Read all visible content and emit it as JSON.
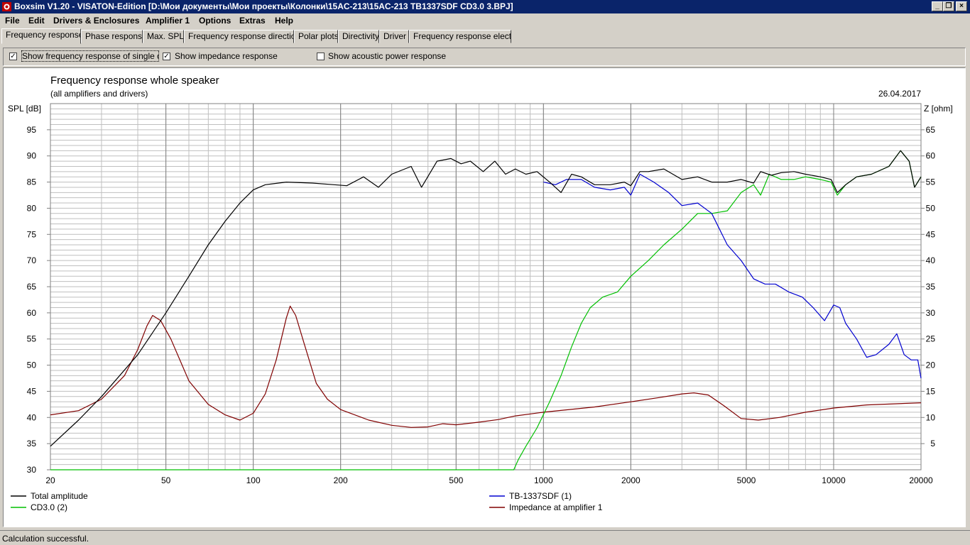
{
  "window": {
    "title": "Boxsim V1.20 - VISATON-Edition [D:\\Мои документы\\Мои проекты\\Колонки\\15AC-213\\15AC-213 TB1337SDF CD3.0 3.BPJ]",
    "minimize_glyph": "_",
    "restore_glyph": "❐",
    "close_glyph": "×"
  },
  "menu": [
    "File",
    "Edit",
    "Drivers & Enclosures",
    "Amplifier 1",
    "Options",
    "Extras",
    "Help"
  ],
  "tabs": [
    "Frequency response.",
    "Phase response",
    "Max. SPL",
    "Frequency response directions",
    "Polar plots",
    "Directivity",
    "Driver",
    "Frequency response electr."
  ],
  "active_tab": 0,
  "options": [
    {
      "label": "Show frequency response of single drive",
      "checked": true
    },
    {
      "label": "Show impedance response",
      "checked": true
    },
    {
      "label": "Show acoustic power response",
      "checked": false
    }
  ],
  "status": "Calculation successful.",
  "colors": {
    "total": "#000000",
    "cd30": "#00c000",
    "tb": "#0000d0",
    "impedance": "#800000",
    "grid": "#bfbfbf",
    "grid_major": "#808080"
  },
  "chart_data": {
    "type": "line",
    "title": "Frequency response whole speaker",
    "subtitle": "(all amplifiers and drivers)",
    "date": "26.04.2017",
    "ylabel": "SPL [dB]",
    "ylabel_right": "Z [ohm]",
    "x_scale": "log",
    "xlim": [
      20,
      20000
    ],
    "ylim": [
      30,
      100
    ],
    "ylim_right": [
      0,
      70
    ],
    "x_ticks": [
      20,
      50,
      100,
      200,
      500,
      1000,
      2000,
      5000,
      10000,
      20000
    ],
    "x_tick_labels": [
      "20",
      "50",
      "100",
      "200",
      "500",
      "1000",
      "2000",
      "5000",
      "10000",
      "20000"
    ],
    "y_ticks": [
      30,
      35,
      40,
      45,
      50,
      55,
      60,
      65,
      70,
      75,
      80,
      85,
      90,
      95
    ],
    "y_right_ticks": [
      5,
      10,
      15,
      20,
      25,
      30,
      35,
      40,
      45,
      50,
      55,
      60,
      65
    ],
    "grid": true,
    "legend_placement": "bottom",
    "series": [
      {
        "name": "Total amplitude",
        "axis": "left",
        "color_key": "total",
        "points": [
          [
            20,
            34.5
          ],
          [
            25,
            39.5
          ],
          [
            30,
            44
          ],
          [
            40,
            52
          ],
          [
            50,
            60
          ],
          [
            60,
            67
          ],
          [
            70,
            73
          ],
          [
            80,
            77.5
          ],
          [
            90,
            81
          ],
          [
            100,
            83.5
          ],
          [
            110,
            84.5
          ],
          [
            130,
            85
          ],
          [
            160,
            84.8
          ],
          [
            190,
            84.5
          ],
          [
            210,
            84.3
          ],
          [
            240,
            86
          ],
          [
            270,
            84
          ],
          [
            300,
            86.5
          ],
          [
            350,
            88
          ],
          [
            380,
            84
          ],
          [
            430,
            89
          ],
          [
            480,
            89.5
          ],
          [
            520,
            88.5
          ],
          [
            560,
            89
          ],
          [
            620,
            87
          ],
          [
            680,
            89
          ],
          [
            740,
            86.5
          ],
          [
            800,
            87.5
          ],
          [
            870,
            86.5
          ],
          [
            950,
            87
          ],
          [
            1050,
            85
          ],
          [
            1150,
            83
          ],
          [
            1250,
            86.5
          ],
          [
            1350,
            86
          ],
          [
            1500,
            84.5
          ],
          [
            1700,
            84.5
          ],
          [
            1900,
            85
          ],
          [
            2000,
            84.3
          ],
          [
            2150,
            87
          ],
          [
            2300,
            87
          ],
          [
            2600,
            87.5
          ],
          [
            3000,
            85.5
          ],
          [
            3400,
            86
          ],
          [
            3800,
            85
          ],
          [
            4300,
            85
          ],
          [
            4800,
            85.5
          ],
          [
            5300,
            84.8
          ],
          [
            5600,
            87
          ],
          [
            6100,
            86.3
          ],
          [
            6600,
            86.8
          ],
          [
            7300,
            87
          ],
          [
            8000,
            86.5
          ],
          [
            9000,
            86
          ],
          [
            9800,
            85.5
          ],
          [
            10300,
            83
          ],
          [
            11000,
            84.5
          ],
          [
            12000,
            86
          ],
          [
            13500,
            86.5
          ],
          [
            15500,
            88
          ],
          [
            17000,
            91
          ],
          [
            18200,
            89
          ],
          [
            19000,
            84
          ],
          [
            20000,
            86
          ]
        ]
      },
      {
        "name": "TB-1337SDF (1)",
        "axis": "left",
        "color_key": "tb",
        "points": [
          [
            1000,
            85
          ],
          [
            1100,
            84.5
          ],
          [
            1200,
            85.5
          ],
          [
            1350,
            85.5
          ],
          [
            1500,
            84
          ],
          [
            1700,
            83.5
          ],
          [
            1900,
            84
          ],
          [
            2000,
            82.5
          ],
          [
            2150,
            86.5
          ],
          [
            2400,
            85
          ],
          [
            2700,
            83
          ],
          [
            3000,
            80.5
          ],
          [
            3400,
            81
          ],
          [
            3800,
            79
          ],
          [
            4300,
            73
          ],
          [
            4800,
            70
          ],
          [
            5300,
            66.5
          ],
          [
            5800,
            65.5
          ],
          [
            6300,
            65.5
          ],
          [
            7000,
            64
          ],
          [
            7800,
            63
          ],
          [
            8500,
            61
          ],
          [
            9300,
            58.5
          ],
          [
            10000,
            61.5
          ],
          [
            10500,
            61
          ],
          [
            11000,
            58
          ],
          [
            12000,
            55
          ],
          [
            13000,
            51.5
          ],
          [
            14000,
            52
          ],
          [
            15500,
            54
          ],
          [
            16500,
            56
          ],
          [
            17500,
            52
          ],
          [
            18500,
            51
          ],
          [
            19500,
            51
          ],
          [
            20000,
            47.5
          ]
        ]
      },
      {
        "name": "CD3.0 (2)",
        "axis": "left",
        "color_key": "cd30",
        "points": [
          [
            20,
            30
          ],
          [
            790,
            30
          ],
          [
            820,
            32
          ],
          [
            870,
            34.5
          ],
          [
            950,
            38
          ],
          [
            1050,
            43
          ],
          [
            1150,
            48
          ],
          [
            1250,
            53.5
          ],
          [
            1350,
            58
          ],
          [
            1450,
            61
          ],
          [
            1600,
            63
          ],
          [
            1800,
            64
          ],
          [
            2000,
            67
          ],
          [
            2300,
            70
          ],
          [
            2600,
            73
          ],
          [
            3000,
            76
          ],
          [
            3400,
            79
          ],
          [
            3800,
            79
          ],
          [
            4300,
            79.5
          ],
          [
            4800,
            83
          ],
          [
            5300,
            84.5
          ],
          [
            5600,
            82.5
          ],
          [
            6000,
            86.5
          ],
          [
            6600,
            85.5
          ],
          [
            7300,
            85.5
          ],
          [
            8000,
            86
          ],
          [
            9000,
            85.5
          ],
          [
            9800,
            85
          ],
          [
            10300,
            82.5
          ],
          [
            11000,
            84.5
          ],
          [
            12000,
            86
          ],
          [
            13500,
            86.5
          ],
          [
            15500,
            88
          ],
          [
            17000,
            91
          ],
          [
            18200,
            89
          ],
          [
            19000,
            84
          ],
          [
            20000,
            86
          ]
        ]
      },
      {
        "name": "Impedance at amplifier 1",
        "axis": "right",
        "color_key": "impedance",
        "points": [
          [
            20,
            10.5
          ],
          [
            25,
            11.3
          ],
          [
            30,
            13.5
          ],
          [
            36,
            18
          ],
          [
            40,
            23
          ],
          [
            43,
            27.5
          ],
          [
            45,
            29.5
          ],
          [
            48,
            28.5
          ],
          [
            52,
            25
          ],
          [
            60,
            17
          ],
          [
            70,
            12.5
          ],
          [
            80,
            10.5
          ],
          [
            90,
            9.5
          ],
          [
            100,
            10.8
          ],
          [
            110,
            14.5
          ],
          [
            120,
            21
          ],
          [
            130,
            29
          ],
          [
            134,
            31.3
          ],
          [
            140,
            29.5
          ],
          [
            150,
            24
          ],
          [
            165,
            16.5
          ],
          [
            180,
            13.5
          ],
          [
            200,
            11.5
          ],
          [
            250,
            9.5
          ],
          [
            300,
            8.5
          ],
          [
            350,
            8.1
          ],
          [
            400,
            8.2
          ],
          [
            450,
            8.8
          ],
          [
            500,
            8.6
          ],
          [
            600,
            9.1
          ],
          [
            700,
            9.6
          ],
          [
            800,
            10.3
          ],
          [
            1000,
            11
          ],
          [
            1500,
            12
          ],
          [
            2000,
            13
          ],
          [
            2500,
            13.8
          ],
          [
            3000,
            14.5
          ],
          [
            3300,
            14.7
          ],
          [
            3700,
            14.3
          ],
          [
            4200,
            12.2
          ],
          [
            4800,
            9.8
          ],
          [
            5500,
            9.5
          ],
          [
            6500,
            10
          ],
          [
            8000,
            11
          ],
          [
            10000,
            11.8
          ],
          [
            13000,
            12.4
          ],
          [
            20000,
            12.8
          ]
        ]
      }
    ]
  }
}
